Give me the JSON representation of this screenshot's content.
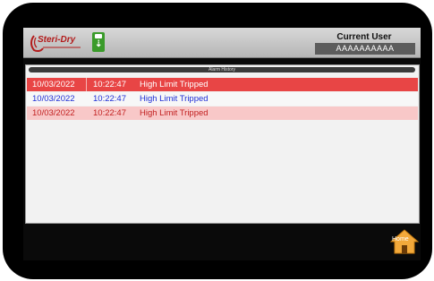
{
  "header": {
    "brand": "Steri-Dry",
    "usb_icon": "usb-drive-icon",
    "current_user_label": "Current User",
    "current_user_value": "AAAAAAAAAA"
  },
  "alarm_history": {
    "title": "Alarm History",
    "rows": [
      {
        "date": "10/03/2022",
        "time": "10:22:47",
        "message": "High Limit Tripped"
      },
      {
        "date": "10/03/2022",
        "time": "10:22:47",
        "message": "High Limit Tripped"
      },
      {
        "date": "10/03/2022",
        "time": "10:22:47",
        "message": "High Limit Tripped"
      }
    ]
  },
  "nav": {
    "home_label": "Home",
    "home_icon": "home-icon"
  },
  "colors": {
    "alarm_active": "#e84545",
    "alarm_acked": "#1f2fd6",
    "alarm_cleared": "#f8c8c8",
    "home_icon": "#f2a93b"
  }
}
